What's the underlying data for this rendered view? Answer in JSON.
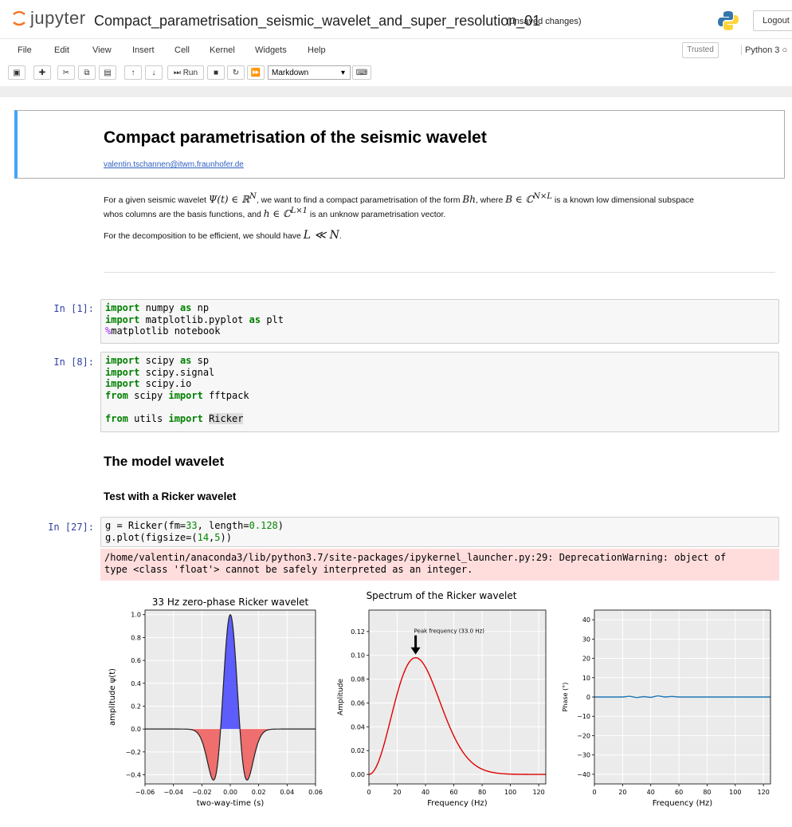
{
  "header": {
    "logo_text": "jupyter",
    "notebook_title": "Compact_parametrisation_seismic_wavelet_and_super_resolution_01",
    "save_status": "(unsaved changes)",
    "logout_label": "Logout"
  },
  "menu": {
    "items": [
      "File",
      "Edit",
      "View",
      "Insert",
      "Cell",
      "Kernel",
      "Widgets",
      "Help"
    ],
    "trusted_label": "Trusted",
    "kernel_name": "Python 3"
  },
  "toolbar": {
    "run_label": "Run",
    "cell_type": "Markdown"
  },
  "cells": {
    "title_heading": "Compact parametrisation of the seismic wavelet",
    "email": "valentin.tschannen@itwm.fraunhofer.de",
    "para1_a": "For a given seismic wavelet ",
    "para1_math1": "Ψ(t) ∈ ℝ",
    "para1_math1_sup": "N",
    "para1_b": ", we want to find a compact parametrisation of the form ",
    "para1_math2": "Bh",
    "para1_c": ", where ",
    "para1_math3": "B ∈ ℂ",
    "para1_math3_sup": "N×L",
    "para1_d": " is a known low dimensional subspace",
    "para1_line2_a": "whos columns are the basis functions, and ",
    "para1_math4": "h ∈ ℂ",
    "para1_math4_sup": "L×1",
    "para1_line2_b": " is an unknow parametrisation vector.",
    "para2_a": "For the decomposition to be efficient, we should have ",
    "para2_math": "L ≪ N",
    "para2_b": ".",
    "prompt1": "In [1]:",
    "prompt2": "In [8]:",
    "prompt3": "In [27]:",
    "section_heading": "The model wavelet",
    "subsection_heading": "Test with a Ricker wavelet",
    "stderr_line1": "/home/valentin/anaconda3/lib/python3.7/site-packages/ipykernel_launcher.py:29: DeprecationWarning: object of",
    "stderr_line2": "type <class 'float'> cannot be safely interpreted as an integer."
  },
  "code": {
    "c1": [
      "import numpy as np",
      "import matplotlib.pyplot as plt",
      "%matplotlib notebook"
    ],
    "c2": [
      "import scipy as sp",
      "import scipy.signal",
      "import scipy.io",
      "from scipy import fftpack",
      "",
      "from utils import Ricker"
    ],
    "c3": [
      "g = Ricker(fm=33, length=0.128)",
      "g.plot(figsize=(14,5))"
    ]
  },
  "chart_data": [
    {
      "type": "area",
      "title": "33 Hz zero-phase Ricker wavelet",
      "xlabel": "two-way-time (s)",
      "ylabel": "amplitude ψ(t)",
      "xlim": [
        -0.06,
        0.06
      ],
      "ylim": [
        -0.48,
        1.04
      ],
      "xticks": [
        "−0.06",
        "−0.04",
        "−0.02",
        "0.00",
        "0.02",
        "0.04",
        "0.06"
      ],
      "yticks": [
        "−0.4",
        "−0.2",
        "0.0",
        "0.2",
        "0.4",
        "0.6",
        "0.8",
        "1.0"
      ],
      "fm": 33,
      "positive_fill": "#4444ff",
      "negative_fill": "#f06060",
      "grid": true
    },
    {
      "type": "line",
      "suptitle": "Spectrum of the Ricker wavelet",
      "xlabel": "Frequency (Hz)",
      "ylabel": "Amplitude",
      "xlim": [
        0,
        125
      ],
      "ylim": [
        -0.008,
        0.138
      ],
      "xticks": [
        "0",
        "20",
        "40",
        "60",
        "80",
        "100",
        "120"
      ],
      "yticks": [
        "0.00",
        "0.02",
        "0.04",
        "0.06",
        "0.08",
        "0.10",
        "0.12"
      ],
      "peak_frequency": 33.0,
      "peak_amplitude": 0.098,
      "annotation": "Peak frequency (33.0 Hz)",
      "color": "#e00000",
      "grid": true
    },
    {
      "type": "line",
      "xlabel": "Frequency (Hz)",
      "ylabel": "Phase (°)",
      "xlim": [
        0,
        125
      ],
      "ylim": [
        -45,
        45
      ],
      "xticks": [
        "0",
        "20",
        "40",
        "60",
        "80",
        "100",
        "120"
      ],
      "yticks": [
        "−40",
        "−30",
        "−20",
        "−10",
        "0",
        "10",
        "20",
        "30",
        "40"
      ],
      "x": [
        0,
        10,
        20,
        25,
        30,
        35,
        40,
        45,
        50,
        55,
        60,
        70,
        80,
        100,
        125
      ],
      "y": [
        0,
        0,
        0,
        0.4,
        -0.3,
        0.2,
        -0.2,
        0.6,
        0,
        0.3,
        0,
        0,
        0,
        0,
        0
      ],
      "color": "#1f77b4",
      "grid": true
    }
  ]
}
